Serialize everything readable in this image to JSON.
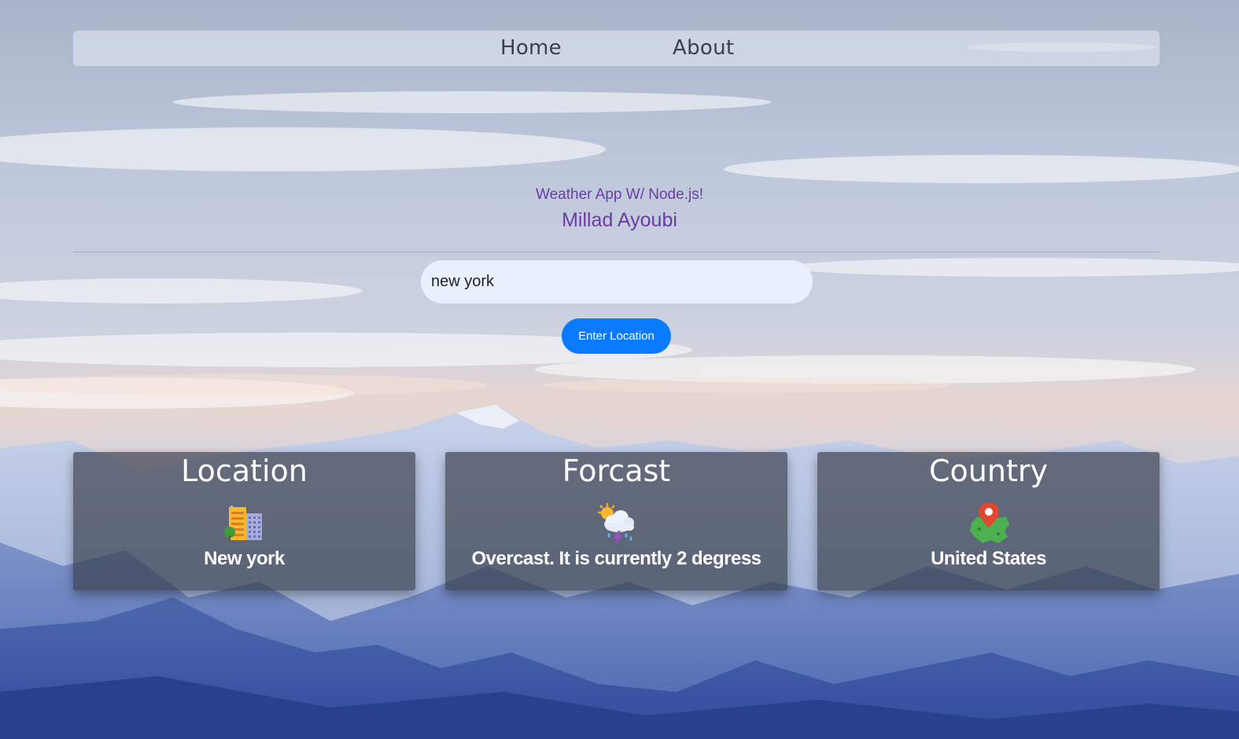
{
  "nav": {
    "home": "Home",
    "about": "About"
  },
  "header": {
    "subtitle": "Weather App W/ Node.js!",
    "author": "Millad Ayoubi"
  },
  "search": {
    "value": "new york",
    "button_label": "Enter Location"
  },
  "cards": [
    {
      "title": "Location",
      "icon": "city-buildings-icon",
      "value": "New york"
    },
    {
      "title": "Forcast",
      "icon": "sun-cloud-storm-icon",
      "value": "Overcast. It is currently 2 degress"
    },
    {
      "title": "Country",
      "icon": "map-pin-icon",
      "value": "United States"
    }
  ],
  "colors": {
    "accent_text": "#6a3da4",
    "button": "#0a7bff",
    "input_bg": "#e8effd"
  }
}
